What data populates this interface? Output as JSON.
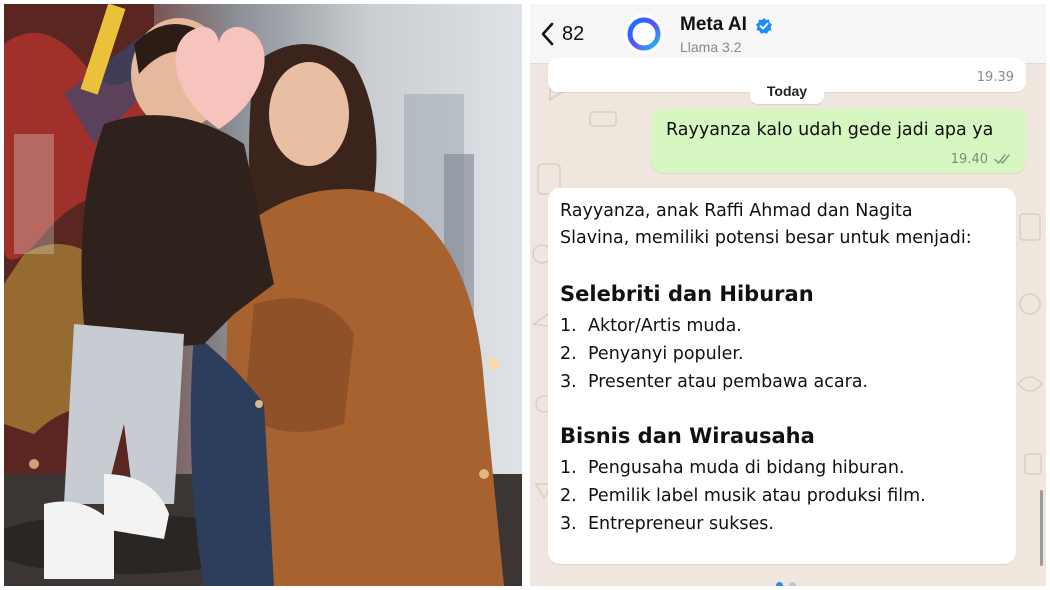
{
  "chat": {
    "back_count": "82",
    "contact_name": "Meta AI",
    "contact_subtitle": "Llama 3.2",
    "previous_message_time": "19.39",
    "date_divider": "Today",
    "outgoing": {
      "text": "Rayyanza kalo udah gede jadi apa ya",
      "time": "19.40",
      "status": "read"
    },
    "incoming": {
      "intro_line1": "Rayyanza, anak Raffi Ahmad dan Nagita",
      "intro_line2": "Slavina, memiliki potensi besar untuk menjadi:",
      "sections": [
        {
          "heading": "Selebriti dan Hiburan",
          "items": [
            {
              "num": "1.",
              "text": "Aktor/Artis muda."
            },
            {
              "num": "2.",
              "text": "Penyanyi populer."
            },
            {
              "num": "3.",
              "text": "Presenter atau pembawa acara."
            }
          ]
        },
        {
          "heading": "Bisnis dan Wirausaha",
          "items": [
            {
              "num": "1.",
              "text": "Pengusaha muda di bidang hiburan."
            },
            {
              "num": "2.",
              "text": "Pemilik label musik atau produksi film."
            },
            {
              "num": "3.",
              "text": "Entrepreneur sukses."
            }
          ]
        }
      ]
    },
    "icons": {
      "back": "chevron-left-icon",
      "avatar": "meta-ai-ring-icon",
      "verified": "verified-badge-icon",
      "ticks": "double-check-icon"
    },
    "colors": {
      "outgoing_bubble": "#d6f7c2",
      "incoming_bubble": "#ffffff",
      "chat_background": "#efe7dd",
      "verified_blue": "#1d8cf8"
    },
    "carousel": {
      "pages": 2,
      "active_page": 1
    }
  }
}
